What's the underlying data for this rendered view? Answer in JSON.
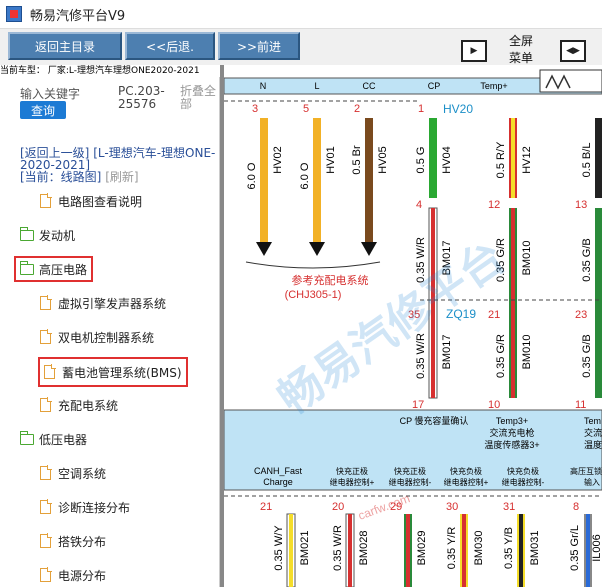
{
  "app": {
    "title": "畅易汽修平台V9"
  },
  "toolbar": {
    "home": "返回主目录",
    "back": "<<后退.",
    "forward": ">>前进",
    "fullscreen": "全屏",
    "menu": "菜单"
  },
  "vehicle": {
    "info": "当前车型：  厂家:L-理想汽车理想ONE2020-2021"
  },
  "left": {
    "keyword_label": "输入关键字",
    "search_label": "查询",
    "code": "PC.203-25576",
    "fold": "折叠全部",
    "breadcrumb_back": "[返回上一级]",
    "breadcrumb_vehicle": "[L-理想汽车-理想ONE-2020-2021]",
    "breadcrumb_current": "[当前：线路图]",
    "breadcrumb_refresh": "[刷新]"
  },
  "tree": {
    "items": [
      {
        "label": "电路图查看说明"
      },
      {
        "label": "发动机"
      },
      {
        "label": "高压电路"
      },
      {
        "label": "虚拟引擎发声器系统"
      },
      {
        "label": "双电机控制器系统"
      },
      {
        "label": "蓄电池管理系统(BMS)"
      },
      {
        "label": "充配电系统"
      },
      {
        "label": "低压电器"
      },
      {
        "label": "空调系统"
      },
      {
        "label": "诊断连接分布"
      },
      {
        "label": "搭铁分布"
      },
      {
        "label": "电源分布"
      }
    ]
  },
  "diagram": {
    "top_pins": [
      "N",
      "L",
      "CC",
      "CP",
      "Temp+"
    ],
    "wires_top": [
      {
        "pin": "3",
        "spec": "6.0 O",
        "name": "HV02"
      },
      {
        "pin": "5",
        "spec": "6.0 O",
        "name": "HV01"
      },
      {
        "pin": "2",
        "spec": "0.5 Br",
        "name": "HV05"
      },
      {
        "pin": "1",
        "spec": "0.5 G",
        "name": "HV04"
      },
      {
        "pin": "",
        "spec": "0.5 R/Y",
        "name": "HV12"
      },
      {
        "pin": "",
        "spec": "0.5 B/L",
        "name": ""
      }
    ],
    "connector_hv20": "HV20",
    "ref_text": "参考充配电系统",
    "ref_code": "(CHJ305-1)",
    "mid_pins": [
      "4",
      "12",
      "13"
    ],
    "wires_mid": [
      {
        "spec": "0.35 W/R",
        "name": "BM017"
      },
      {
        "spec": "0.35 G/R",
        "name": "BM010"
      },
      {
        "spec": "0.35 G/B",
        "name": ""
      }
    ],
    "connector_zq19": "ZQ19",
    "mid2_pins": [
      "35",
      "21",
      "23"
    ],
    "low_pins": [
      "17",
      "10",
      "11"
    ],
    "module_labels": [
      {
        "text": "CP 慢充容量确认"
      },
      {
        "text": "Temp3+"
      },
      {
        "text": "交流充电枪"
      },
      {
        "text": "温度传感器3+"
      },
      {
        "text": "Tem"
      },
      {
        "text": "交流"
      },
      {
        "text": "温度"
      }
    ],
    "bottom_labels": [
      {
        "l1": "CANH_Fast",
        "l2": "Charge"
      },
      {
        "l1": "快充正极",
        "l2": "继电器控制+"
      },
      {
        "l1": "快充正极",
        "l2": "继电器控制-"
      },
      {
        "l1": "快充负极",
        "l2": "继电器控制+"
      },
      {
        "l1": "快充负极",
        "l2": "继电器控制-"
      },
      {
        "l1": "高压互锁",
        "l2": "输入"
      }
    ],
    "bottom_pins": [
      "21",
      "20",
      "29",
      "30",
      "31",
      "8"
    ],
    "bottom_wires": [
      {
        "spec": "0.35 W/Y",
        "name": "BM021"
      },
      {
        "spec": "0.35 W/R",
        "name": "BM028"
      },
      {
        "spec": "0.35 G/R",
        "name": "BM029"
      },
      {
        "spec": "0.35 Y/R",
        "name": "BM030"
      },
      {
        "spec": "0.35 Y/B",
        "name": "BM031"
      },
      {
        "spec": "0.35 Gr/L",
        "name": "IL006"
      }
    ],
    "watermark": "畅易汽修平台",
    "watermark_url": "carfw.com"
  }
}
